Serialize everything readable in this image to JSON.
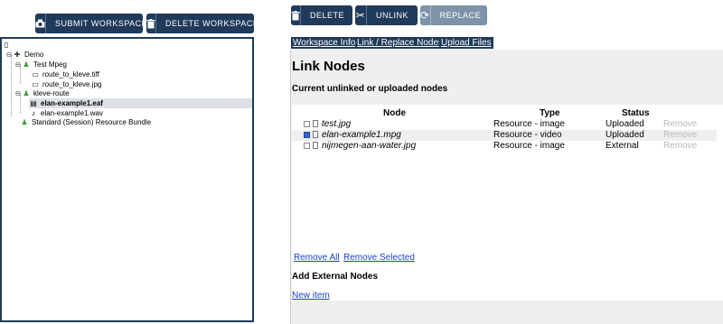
{
  "tree_toolbar": {
    "submit_label": "SUBMIT WORKSPACE",
    "delete_label": "DELETE WORKSPACE"
  },
  "tree": {
    "nodes": [
      {
        "label": "Demo"
      },
      {
        "label": "Test Mpeg"
      },
      {
        "label": "route_to_kleve.tiff"
      },
      {
        "label": "route_to_kleve.jpg"
      },
      {
        "label": "kleve-route"
      },
      {
        "label": "elan-example1.eaf",
        "selected": true
      },
      {
        "label": "elan-example1.wav"
      },
      {
        "label": "Standard (Session) Resource Bundle"
      }
    ]
  },
  "main_toolbar": {
    "delete_label": "DELETE",
    "unlink_label": "UNLINK",
    "replace_label": "REPLACE"
  },
  "tabs": [
    {
      "label": "Workspace Info"
    },
    {
      "label": "Link / Replace Nodes"
    },
    {
      "label": "Upload Files"
    }
  ],
  "panel": {
    "title": "Link Nodes",
    "subtitle": "Current unlinked or uploaded nodes",
    "columns": {
      "node": "Node",
      "type": "Type",
      "status": "Status"
    },
    "rows": [
      {
        "node": "test.jpg",
        "type": "Resource - image",
        "status": "Uploaded",
        "action": "Remove",
        "checked": false
      },
      {
        "node": "elan-example1.mpg",
        "type": "Resource - video",
        "status": "Uploaded",
        "action": "Remove",
        "checked": true
      },
      {
        "node": "nijmegen-aan-water.jpg",
        "type": "Resource - image",
        "status": "External",
        "action": "Remove",
        "checked": false
      }
    ],
    "remove_all": "Remove All",
    "remove_selected": "Remove Selected",
    "external_heading": "Add External Nodes",
    "new_item": "New item"
  }
}
